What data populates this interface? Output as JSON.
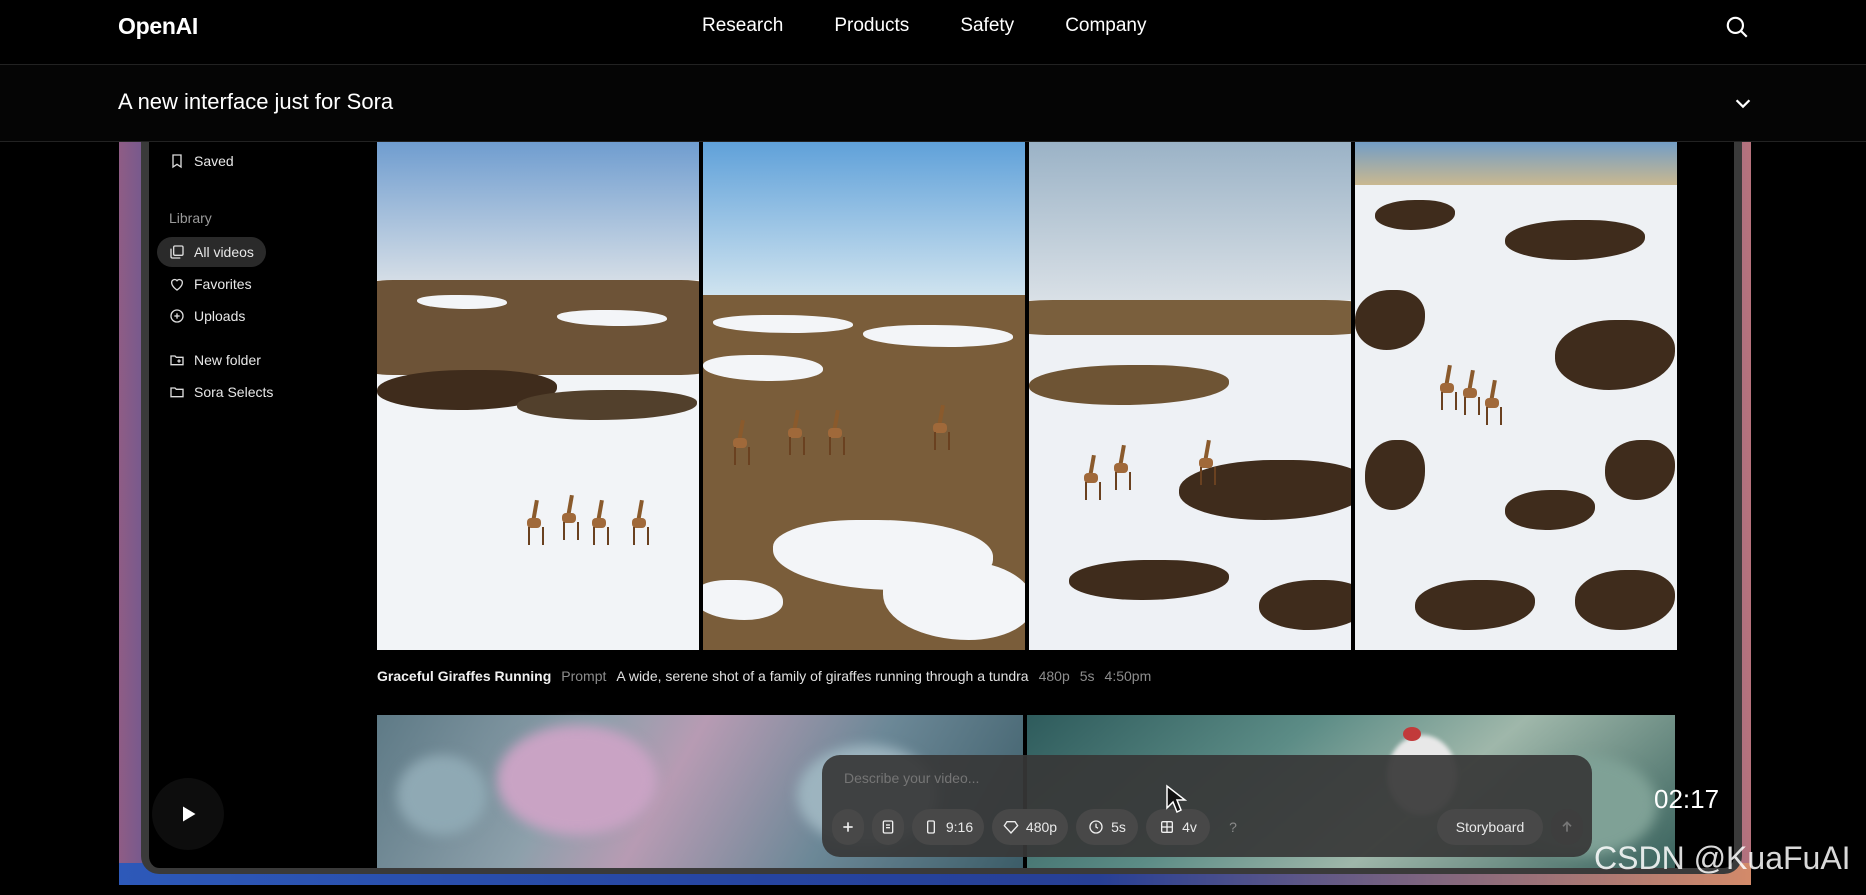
{
  "nav": {
    "logo": "OpenAI",
    "links": [
      "Research",
      "Products",
      "Safety",
      "Company"
    ]
  },
  "subbar": {
    "title": "A new interface just for Sora"
  },
  "sidebar": {
    "saved": "Saved",
    "library_heading": "Library",
    "items": [
      "All videos",
      "Favorites",
      "Uploads"
    ],
    "folders": [
      "New folder",
      "Sora Selects"
    ]
  },
  "caption": {
    "title": "Graceful Giraffes Running",
    "prompt_label": "Prompt",
    "prompt_text": "A wide, serene shot of a family of giraffes running through a tundra",
    "resolution": "480p",
    "duration": "5s",
    "time": "4:50pm"
  },
  "prompt_bar": {
    "placeholder": "Describe your video...",
    "aspect": "9:16",
    "resolution": "480p",
    "duration": "5s",
    "variations": "4v",
    "help": "?",
    "storyboard": "Storyboard"
  },
  "player": {
    "timestamp": "02:17"
  },
  "watermark": "CSDN @KuaFuAI",
  "colors": {
    "background": "#000000",
    "accent_frame_left": "#2b54a8",
    "accent_frame_right": "#b6727c"
  }
}
